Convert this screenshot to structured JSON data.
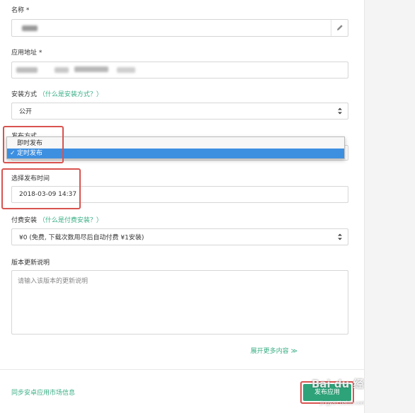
{
  "form": {
    "name": {
      "label": "名称 *",
      "value_hidden": true
    },
    "app_url": {
      "label": "应用地址 *",
      "value_hidden": true
    },
    "install_method": {
      "label": "安装方式",
      "help_link": "（什么是安装方式？）",
      "value": "公开"
    },
    "publish_method": {
      "label": "发布方式",
      "options": [
        "即时发布",
        "定时发布"
      ],
      "selected": "定时发布",
      "check": "✓"
    },
    "publish_time": {
      "label": "选择发布时间",
      "value": "2018-03-09 14:37"
    },
    "paid_install": {
      "label": "付费安装",
      "help_link": "（什么是付费安装？）",
      "value": "¥0 (免费, 下载次数用尽后自动付费 ¥1安装)"
    },
    "release_notes": {
      "label": "版本更新说明",
      "placeholder": "请输入该版本的更新说明"
    },
    "expand_more": "展开更多内容 ≫",
    "sync_link": "同步安卓应用市场信息",
    "publish_button": "发布应用"
  },
  "watermark": {
    "main": "Bai du 经验",
    "sub": "jingyan.baidu.com"
  },
  "colors": {
    "accent": "#3aaf85",
    "button": "#2ea37a",
    "highlight": "#d9534f",
    "selection": "#3d8fe0"
  }
}
